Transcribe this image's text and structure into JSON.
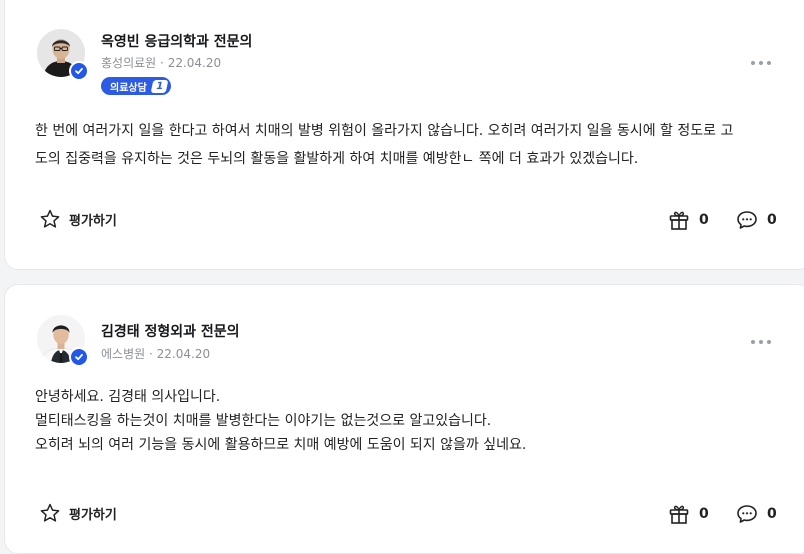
{
  "answers": [
    {
      "name": "옥영빈 응급의학과 전문의",
      "hospital": "홍성의료원",
      "date": "22.04.20",
      "badge_label": "의료상담",
      "badge_number": "1",
      "body_lines": [
        "한 번에 여러가지 일을 한다고 하여서 치매의 발병 위험이 올라가지 않습니다. 오히려 여러가지 일을 동시에 할 정도로 고",
        "도의 집중력을 유지하는 것은 두뇌의 활동을 활발하게 하여 치매를 예방한ㄴ 쪽에 더 효과가 있겠습니다."
      ],
      "rate_label": "평가하기",
      "gift_count": "0",
      "comment_count": "0"
    },
    {
      "name": "김경태 정형외과 전문의",
      "hospital": "에스병원",
      "date": "22.04.20",
      "body_lines": [
        "안녕하세요. 김경태 의사입니다.",
        "멀티태스킹을 하는것이 치매를 발병한다는 이야기는 없는것으로 알고있습니다.",
        "오히려 뇌의 여러 기능을 동시에 활용하므로 치매 예방에 도움이 되지 않을까 싶네요."
      ],
      "rate_label": "평가하기",
      "gift_count": "0",
      "comment_count": "0"
    }
  ],
  "meta_separator": "·",
  "icons": {
    "verified": "verified-check-icon",
    "more": "more-dots-icon",
    "star": "star-outline-icon",
    "gift": "gift-icon",
    "comment": "comment-bubble-icon"
  },
  "colors": {
    "accent": "#2d5be3",
    "muted": "#8b8f97"
  }
}
